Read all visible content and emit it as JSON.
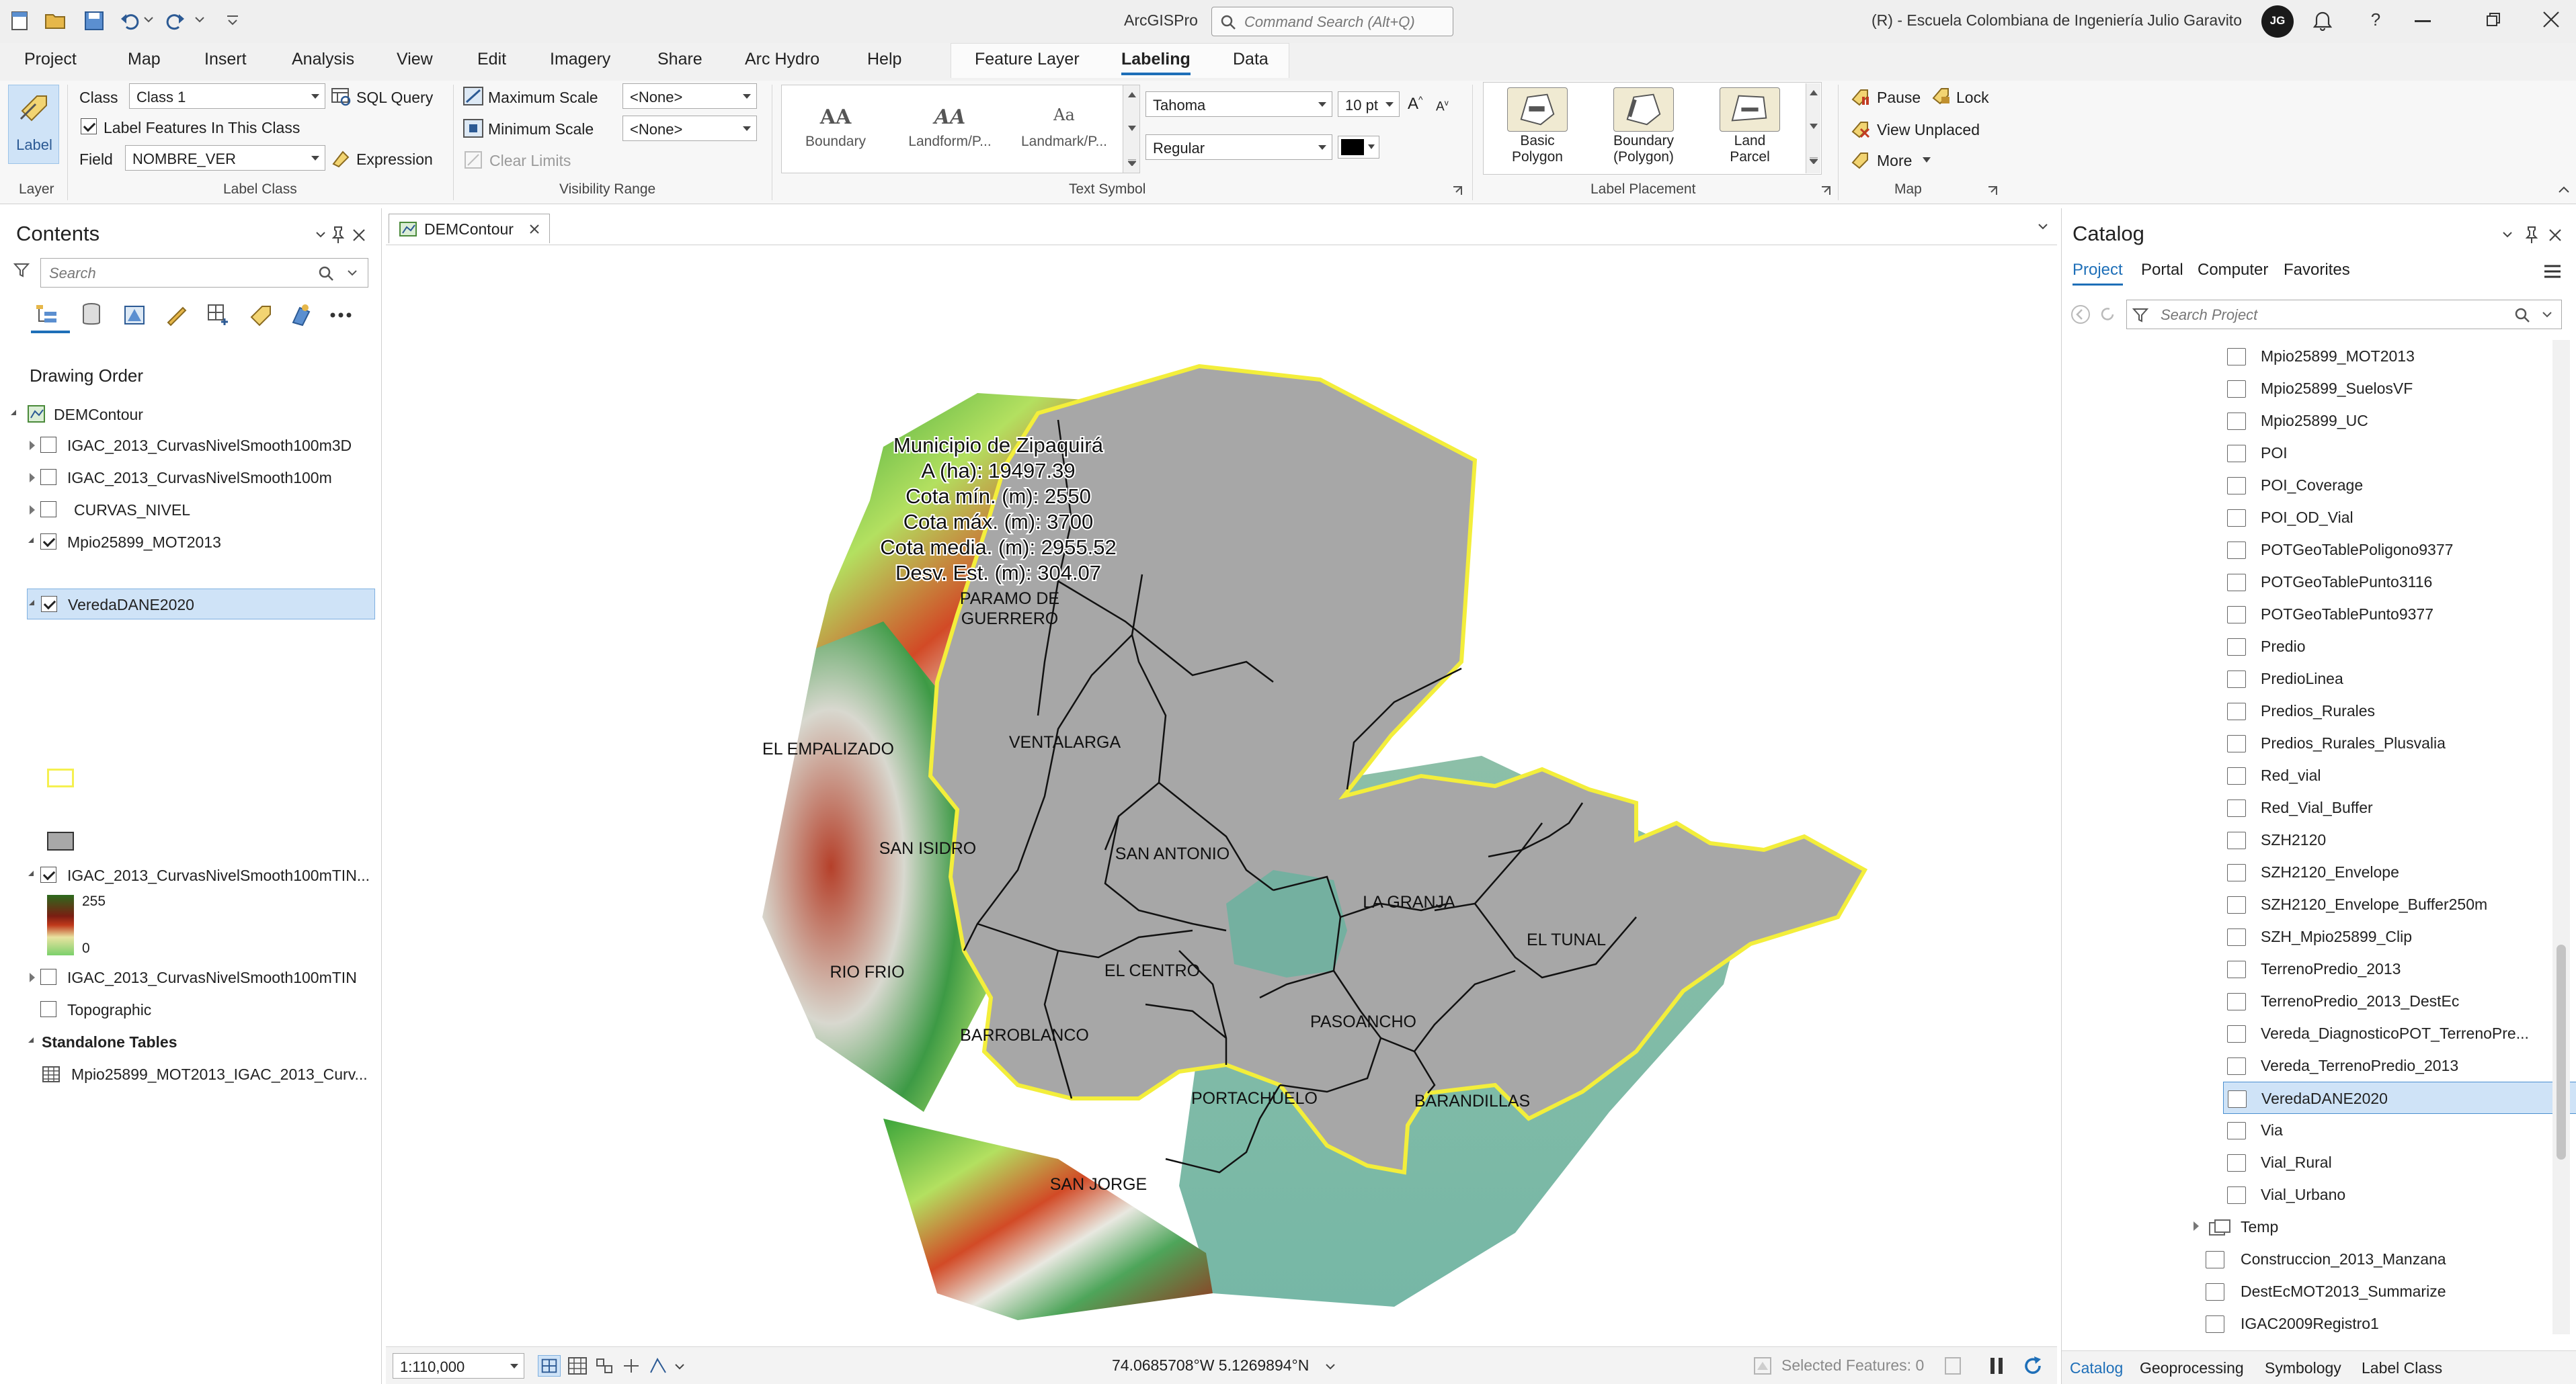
{
  "app": {
    "name": "ArcGISPro",
    "command_search_placeholder": "Command Search (Alt+Q)",
    "org": "(R) - Escuela Colombiana de Ingeniería Julio Garavito",
    "avatar_initials": "JG"
  },
  "menu": {
    "items": [
      "Project",
      "Map",
      "Insert",
      "Analysis",
      "View",
      "Edit",
      "Imagery",
      "Share",
      "Arc Hydro",
      "Help"
    ],
    "contextual": [
      "Feature Layer",
      "Labeling",
      "Data"
    ],
    "active": "Labeling"
  },
  "ribbon": {
    "layer": {
      "label_button": "Label",
      "group": "Layer"
    },
    "label_class": {
      "class_label": "Class",
      "class_value": "Class 1",
      "sql_query": "SQL Query",
      "label_features": "Label Features In This Class",
      "field_label": "Field",
      "field_value": "NOMBRE_VER",
      "expression": "Expression",
      "group": "Label Class"
    },
    "visibility": {
      "max_scale": "Maximum Scale",
      "max_value": "<None>",
      "min_scale": "Minimum Scale",
      "min_value": "<None>",
      "clear": "Clear Limits",
      "group": "Visibility Range"
    },
    "text_symbol": {
      "gallery": [
        {
          "symbol": "AA",
          "label": "Boundary"
        },
        {
          "symbol": "AA",
          "label": "Landform/P..."
        },
        {
          "symbol": "Aa",
          "label": "Landmark/P..."
        }
      ],
      "font": "Tahoma",
      "size": "10 pt",
      "style": "Regular",
      "color": "#000000",
      "group": "Text Symbol"
    },
    "label_placement": {
      "buttons": [
        {
          "line1": "Basic",
          "line2": "Polygon"
        },
        {
          "line1": "Boundary",
          "line2": "(Polygon)"
        },
        {
          "line1": "Land",
          "line2": "Parcel"
        }
      ],
      "group": "Label Placement"
    },
    "map": {
      "pause": "Pause",
      "lock": "Lock",
      "view_unplaced": "View Unplaced",
      "more": "More",
      "group": "Map"
    }
  },
  "contents": {
    "title": "Contents",
    "search_placeholder": "Search",
    "drawing_order": "Drawing Order",
    "map_name": "DEMContour",
    "layers": [
      {
        "name": "IGAC_2013_CurvasNivelSmooth100m3D",
        "checked": false
      },
      {
        "name": "IGAC_2013_CurvasNivelSmooth100m",
        "checked": false
      },
      {
        "name": "CURVAS_NIVEL",
        "checked": false
      },
      {
        "name": "Mpio25899_MOT2013",
        "checked": true
      },
      {
        "name": "VeredaDANE2020",
        "checked": true
      },
      {
        "name": "IGAC_2013_CurvasNivelSmooth100mTIN...",
        "checked": true
      },
      {
        "name": "IGAC_2013_CurvasNivelSmooth100mTIN",
        "checked": false
      },
      {
        "name": "Topographic",
        "checked": false
      }
    ],
    "ramp_high": "255",
    "ramp_low": "0",
    "standalone_tables": "Standalone Tables",
    "table": "Mpio25899_MOT2013_IGAC_2013_Curv..."
  },
  "map": {
    "tab": "DEMContour",
    "scale": "1:110,000",
    "coordinates": "74.0685708°W 5.1269894°N",
    "selected_features": "Selected Features: 0",
    "info_lines": [
      "Municipio de Zipaquirá",
      "A (ha): 19497.39",
      "Cota mín. (m): 2550",
      "Cota máx. (m): 3700",
      "Cota media. (m): 2955.52",
      "Desv. Est. (m): 304.07"
    ],
    "veredas": [
      "PARAMO DE",
      "GUERRERO",
      "EL EMPALIZADO",
      "VENTALARGA",
      "SAN ISIDRO",
      "SAN ANTONIO",
      "LA GRANJA",
      "EL TUNAL",
      "RIO FRIO",
      "EL CENTRO",
      "BARROBLANCO",
      "PASOANCHO",
      "PORTACHUELO",
      "BARANDILLAS",
      "SAN JORGE"
    ]
  },
  "catalog": {
    "title": "Catalog",
    "tabs": [
      "Project",
      "Portal",
      "Computer",
      "Favorites"
    ],
    "search_placeholder": "Search Project",
    "items": [
      "Mpio25899_MOT2013",
      "Mpio25899_SuelosVF",
      "Mpio25899_UC",
      "POI",
      "POI_Coverage",
      "POI_OD_Vial",
      "POTGeoTablePoligono9377",
      "POTGeoTablePunto3116",
      "POTGeoTablePunto9377",
      "Predio",
      "PredioLinea",
      "Predios_Rurales",
      "Predios_Rurales_Plusvalia",
      "Red_vial",
      "Red_Vial_Buffer",
      "SZH2120",
      "SZH2120_Envelope",
      "SZH2120_Envelope_Buffer250m",
      "SZH_Mpio25899_Clip",
      "TerrenoPredio_2013",
      "TerrenoPredio_2013_DestEc",
      "Vereda_DiagnosticoPOT_TerrenoPre...",
      "Vereda_TerrenoPredio_2013",
      "VeredaDANE2020",
      "Via",
      "Vial_Rural",
      "Vial_Urbano"
    ],
    "selected": "VeredaDANE2020",
    "folder": "Temp",
    "tables": [
      "Construccion_2013_Manzana",
      "DestEcMOT2013_Summarize",
      "IGAC2009Registro1"
    ],
    "bottom_tabs": [
      "Catalog",
      "Geoprocessing",
      "Symbology",
      "Label Class"
    ]
  }
}
